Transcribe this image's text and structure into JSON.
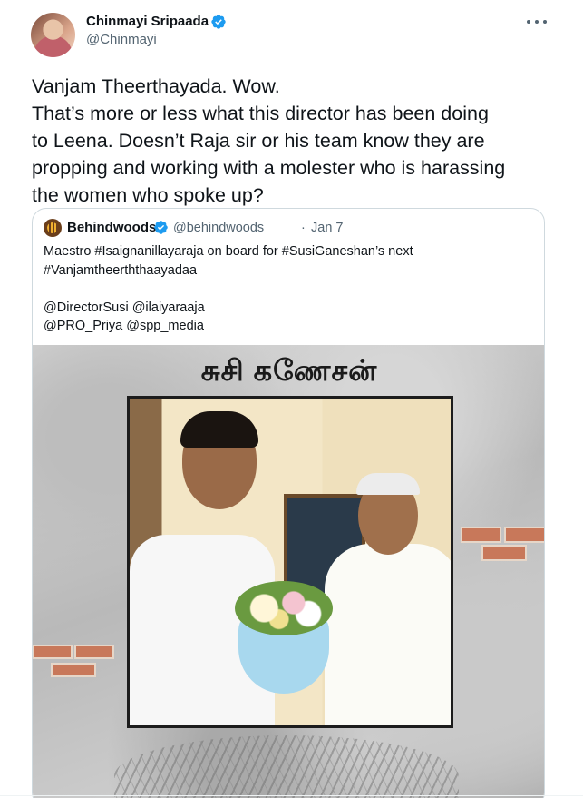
{
  "tweet": {
    "author_name": "Chinmayi Sripaada",
    "handle": "@Chinmayi",
    "verified": true,
    "text_lines": [
      "Vanjam Theerthayada. Wow.",
      "That’s more or less what this director has been doing",
      "to Leena. Doesn’t Raja sir or his team know they are",
      "propping and working with a molester who is harassing",
      "the women who spoke up?"
    ],
    "more_icon": "more-horizontal-icon"
  },
  "quote": {
    "author_name": "Behindwoods",
    "handle": "@behindwoods",
    "separator": "·",
    "date": "Jan 7",
    "verified": true,
    "text_lines": [
      "Maestro #Isaignanillayaraja on board for #SusiGaneshan’s next",
      "#Vanjamtheerththaayadaa",
      "",
      "@DirectorSusi @ilaiyaraaja",
      "@PRO_Priya @spp_media"
    ],
    "image": {
      "poster_title": "சுசி கணேசன்"
    }
  },
  "colors": {
    "verified_blue": "#1d9bf0",
    "secondary_text": "#536471",
    "border": "#cfd9de"
  }
}
